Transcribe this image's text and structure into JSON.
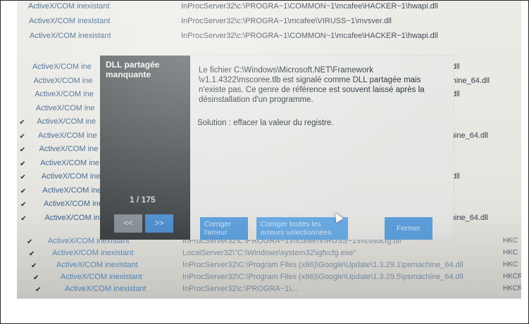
{
  "rows_top": [
    {
      "kind": "ActiveX/COM inexistant",
      "path": "InProcServer32\\c:\\PROGRA~1\\COMMON~1\\mcafee\\HACKER~1\\hwapi.dll",
      "style": "top",
      "check": false
    },
    {
      "kind": "ActiveX/COM inexistant",
      "path": "InProcServer32\\c:\\PROGRA~1\\mcafee\\VIRUSS~1\\mvsver.dll",
      "style": "top",
      "check": false
    },
    {
      "kind": "ActiveX/COM inexistant",
      "path": "InProcServer32\\c:\\PROGRA~1\\COMMON~1\\mcafee\\HACKER~1\\hwapi.dll",
      "style": "top",
      "check": false
    }
  ],
  "rows_mid": [
    {
      "kind": "ActiveX/COM ine",
      "tail": "api.dll",
      "check": false
    },
    {
      "kind": "ActiveX/COM ine",
      "tail": "nachine_64.dll",
      "check": false
    },
    {
      "kind": "ActiveX/COM ine",
      "tail": "api.dll",
      "check": false
    },
    {
      "kind": "ActiveX/COM ine",
      "tail": "",
      "check": false
    },
    {
      "kind": "ActiveX/COM ine",
      "tail": "",
      "check": true
    },
    {
      "kind": "ActiveX/COM ine",
      "tail": "machine_64.dll",
      "check": true
    },
    {
      "kind": "ActiveX/COM ine",
      "tail": "",
      "check": true
    },
    {
      "kind": "ActiveX/COM ine",
      "tail": "",
      "check": true
    },
    {
      "kind": "ActiveX/COM ine",
      "tail": "api.dll",
      "check": true
    },
    {
      "kind": "ActiveX/COM ine",
      "tail": "",
      "check": true
    },
    {
      "kind": "ActiveX/COM ine",
      "tail": "",
      "check": true
    },
    {
      "kind": "ActiveX/COM ine",
      "tail": "machine_64.dll",
      "check": true
    }
  ],
  "rows_bottom": [
    {
      "kind": "ActiveX/COM inexistant",
      "path": "InProcServer32\\c:\\PROGRA~1\\mcafee\\VIRUSS~1\\mcvsocfg.dll",
      "extra": "HKC",
      "check": true
    },
    {
      "kind": "ActiveX/COM inexistant",
      "path": "LocalServer32\\\"C:\\Windows\\system32\\igfxcfg.exe\"",
      "extra": "HKC",
      "check": true
    },
    {
      "kind": "ActiveX/COM inexistant",
      "path": "InProcServer32\\C:\\Program Files (x86)\\Google\\Update\\1.3.29.1\\psmachine_64.dll",
      "extra": "HKC",
      "check": true
    },
    {
      "kind": "ActiveX/COM inexistant",
      "path": "InProcServer32\\C:\\Program Files (x86)\\Google\\Update\\1.3.29.5\\psmachine_64.dll",
      "extra": "HKCR",
      "check": true
    },
    {
      "kind": "ActiveX/COM inexistant",
      "path": "InProcServer32\\c:\\PROGRA~1\\...",
      "extra": "HKCR",
      "check": true
    }
  ],
  "side_panel": {
    "title_line1": "DLL partagée",
    "title_line2": "manquante",
    "counter": "1 / 175",
    "prev_label": "<<",
    "next_label": ">>"
  },
  "dialog": {
    "message": "Le fichier C:\\Windows\\Microsoft.NET\\Framework \\v1.1.4322\\mscoree.tlb est signalé comme DLL partagée mais n'existe pas. Ce genre de référence est souvent laissé après la désinstallation d'un programme.",
    "solution": "Solution : effacer la valeur du registre.",
    "fix_label": "Corriger l'erreur",
    "fix_all_label": "Corriger toutes les erreurs sélectionnées",
    "close_label": "Fermer"
  },
  "colors": {
    "accent": "#5d9fdc",
    "panel": "#464b4d"
  }
}
